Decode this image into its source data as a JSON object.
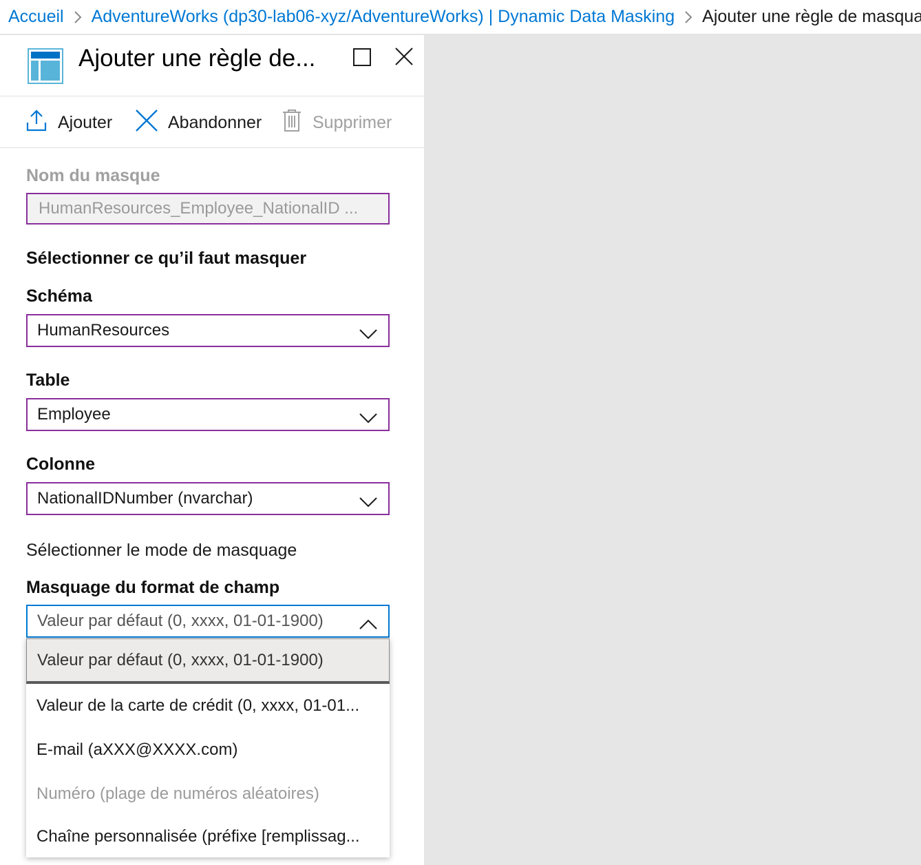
{
  "breadcrumb": {
    "home": "Accueil",
    "parent": "AdventureWorks (dp30-lab06-xyz/AdventureWorks) | Dynamic Data Masking",
    "current": "Ajouter une règle de masquage"
  },
  "blade": {
    "title": "Ajouter une règle de...",
    "icon": "table-icon"
  },
  "toolbar": {
    "add_label": "Ajouter",
    "discard_label": "Abandonner",
    "delete_label": "Supprimer"
  },
  "form": {
    "mask_name_label": "Nom du masque",
    "mask_name_value": "HumanResources_Employee_NationalID ...",
    "select_section": "Sélectionner ce qu’il faut masquer",
    "schema_label": "Schéma",
    "schema_value": "HumanResources",
    "table_label": "Table",
    "table_value": "Employee",
    "column_label": "Colonne",
    "column_value": "NationalIDNumber (nvarchar)",
    "mode_section": "Sélectionner le mode de masquage",
    "format_label": "Masquage du format de champ",
    "format_value": "Valeur par défaut (0, xxxx, 01-01-1900)"
  },
  "dropdown": {
    "options": [
      {
        "label": "Valeur par défaut (0, xxxx, 01-01-1900)",
        "state": "selected"
      },
      {
        "label": "Valeur de la carte de crédit (0, xxxx, 01-01...",
        "state": "normal"
      },
      {
        "label": "E-mail (aXXX@XXXX.com)",
        "state": "normal"
      },
      {
        "label": "Numéro (plage de numéros aléatoires)",
        "state": "disabled"
      },
      {
        "label": "Chaîne personnalisée (préfixe [remplissag...",
        "state": "normal"
      }
    ]
  },
  "colors": {
    "link": "#0078d4",
    "field_border": "#8a2d9c",
    "focus_border": "#0078d4",
    "disabled_text": "#a0a0a0"
  }
}
